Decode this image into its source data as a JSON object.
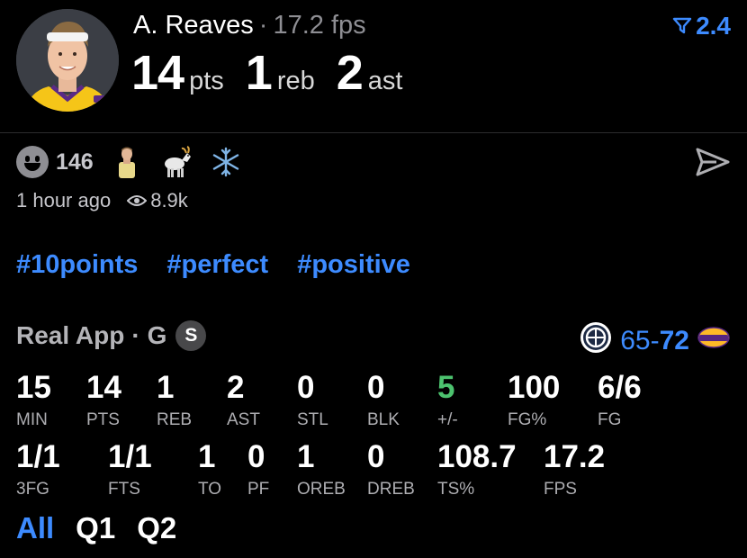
{
  "header": {
    "player_name": "A. Reaves",
    "separator": "·",
    "fps_text": "17.2 fps",
    "pts_value": "14",
    "pts_label": "pts",
    "reb_value": "1",
    "reb_label": "reb",
    "ast_value": "2",
    "ast_label": "ast",
    "rating_icon": "filter-funnel-icon",
    "rating_value": "2.4"
  },
  "reactions": {
    "count": "146",
    "emojis": [
      "player-emoji-icon",
      "goat-emoji-icon",
      "snowflake-emoji-icon"
    ]
  },
  "meta": {
    "time_ago": "1 hour ago",
    "views": "8.9k"
  },
  "tags": [
    "#10points",
    "#perfect",
    "#positive"
  ],
  "game": {
    "source": "Real App",
    "separator": "·",
    "position": "G",
    "badge": "S",
    "score_left": "65",
    "score_sep": "-",
    "score_right": "72"
  },
  "stats": {
    "row1": [
      {
        "value": "15",
        "label": "MIN"
      },
      {
        "value": "14",
        "label": "PTS"
      },
      {
        "value": "1",
        "label": "REB"
      },
      {
        "value": "2",
        "label": "AST"
      },
      {
        "value": "0",
        "label": "STL"
      },
      {
        "value": "0",
        "label": "BLK"
      },
      {
        "value": "5",
        "label": "+/-"
      },
      {
        "value": "100",
        "label": "FG%"
      },
      {
        "value": "6/6",
        "label": "FG"
      }
    ],
    "row2": [
      {
        "value": "1/1",
        "label": "3FG"
      },
      {
        "value": "1/1",
        "label": "FTS"
      },
      {
        "value": "1",
        "label": "TO"
      },
      {
        "value": "0",
        "label": "PF"
      },
      {
        "value": "1",
        "label": "OREB"
      },
      {
        "value": "0",
        "label": "DREB"
      },
      {
        "value": "108.7",
        "label": "TS%"
      },
      {
        "value": "17.2",
        "label": "FPS"
      }
    ]
  },
  "tabs": [
    "All",
    "Q1",
    "Q2"
  ],
  "colors": {
    "accent": "#3d8bff",
    "positive": "#4cc26e",
    "background": "#000000",
    "muted": "#8e8e93"
  }
}
